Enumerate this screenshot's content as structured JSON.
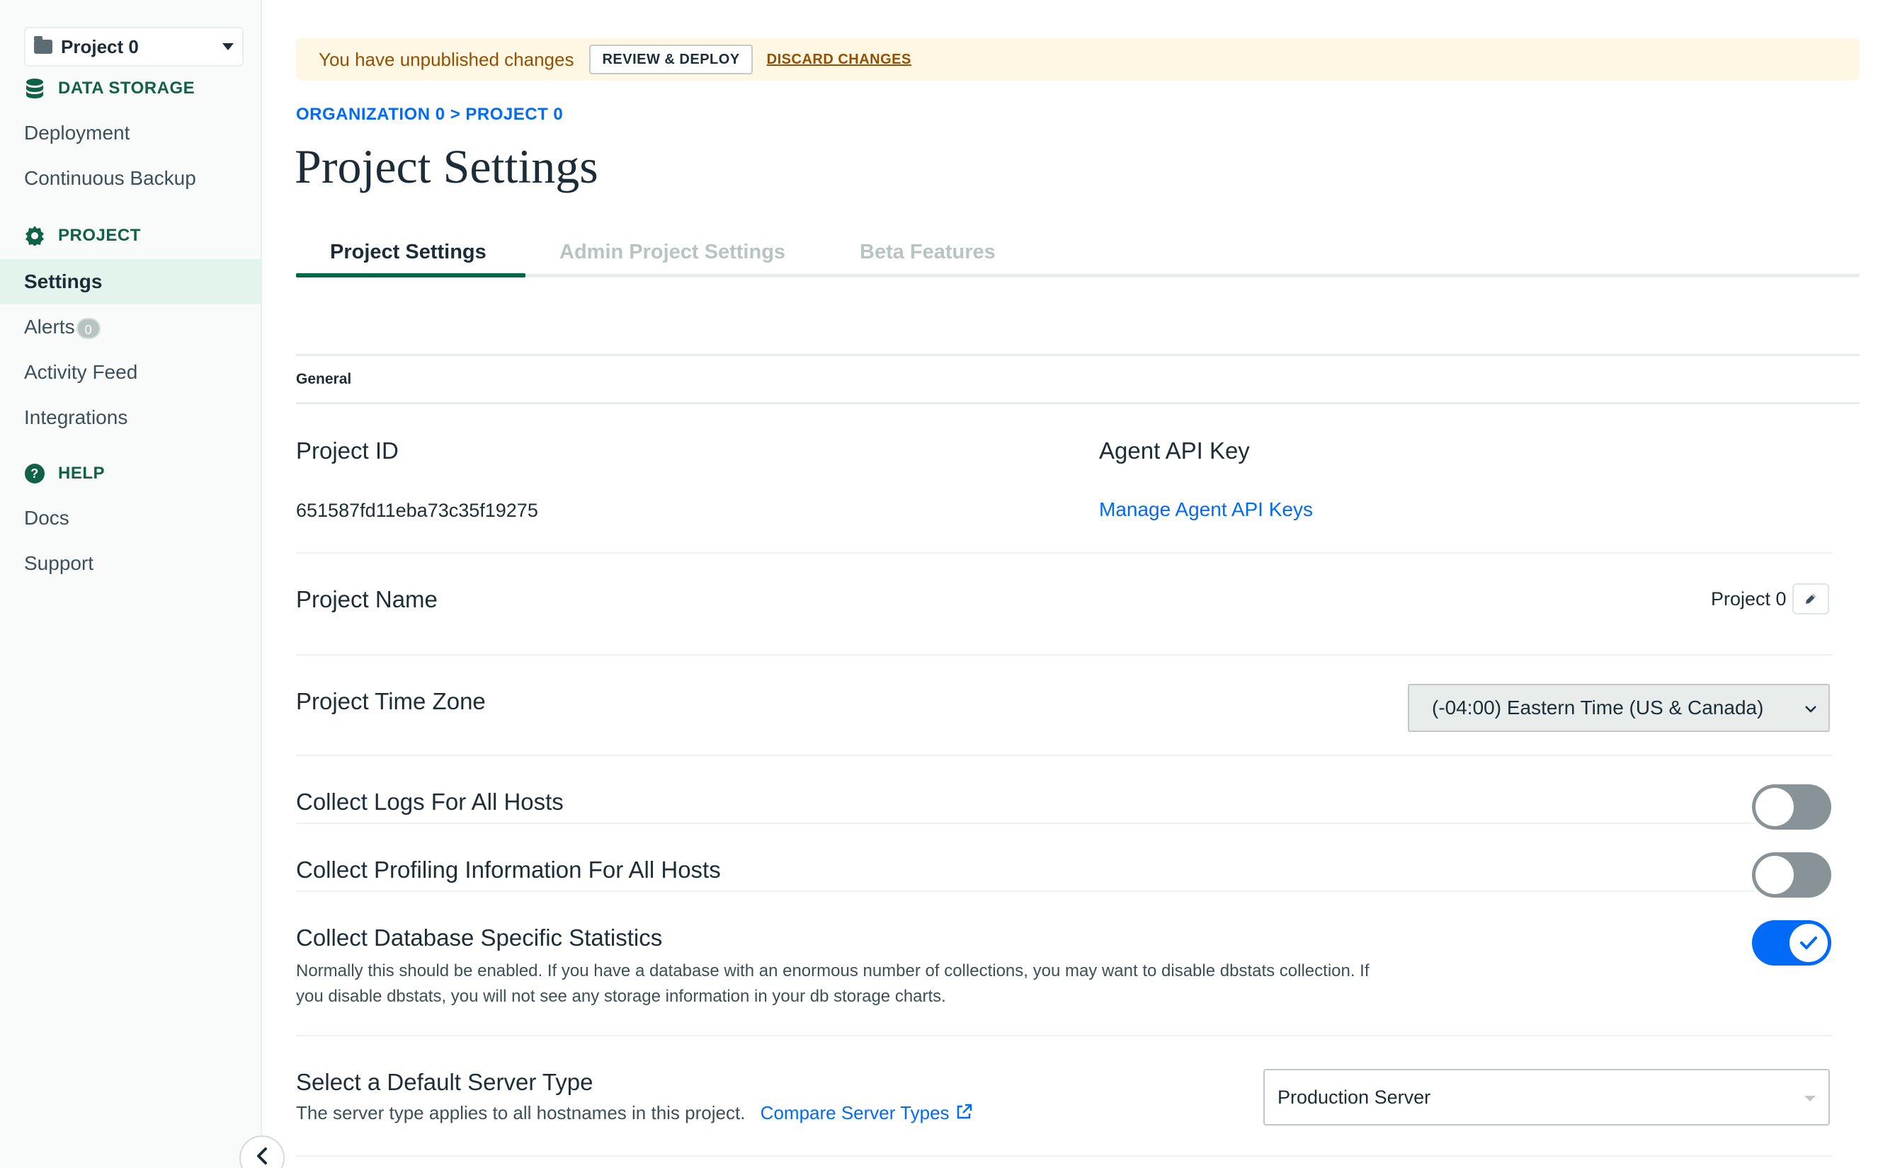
{
  "sidebar": {
    "project_selector": "Project 0",
    "sections": [
      {
        "title": "DATA STORAGE",
        "icon": "database-icon",
        "items": [
          "Deployment",
          "Continuous Backup"
        ]
      },
      {
        "title": "PROJECT",
        "icon": "gear-icon",
        "items": [
          "Settings",
          "Alerts",
          "Activity Feed",
          "Integrations"
        ]
      },
      {
        "title": "HELP",
        "icon": "help-circle-icon",
        "items": [
          "Docs",
          "Support"
        ]
      }
    ],
    "alerts_count": "0",
    "active_item": "Settings"
  },
  "banner": {
    "text": "You have unpublished changes",
    "review_label": "REVIEW & DEPLOY",
    "discard_label": "DISCARD CHANGES"
  },
  "breadcrumb": "ORGANIZATION 0 > PROJECT 0",
  "page_title": "Project Settings",
  "tabs": [
    {
      "label": "Project Settings",
      "active": true
    },
    {
      "label": "Admin Project Settings",
      "active": false
    },
    {
      "label": "Beta Features",
      "active": false
    }
  ],
  "general": {
    "heading": "General",
    "project_id_label": "Project ID",
    "project_id_value": "651587fd11eba73c35f19275",
    "agent_api_label": "Agent API Key",
    "agent_api_link": "Manage Agent API Keys",
    "project_name_label": "Project Name",
    "project_name_value": "Project 0",
    "timezone_label": "Project Time Zone",
    "timezone_value": "(-04:00) Eastern Time (US & Canada)",
    "collect_logs_label": "Collect Logs For All Hosts",
    "collect_logs_on": false,
    "collect_profiling_label": "Collect Profiling Information For All Hosts",
    "collect_profiling_on": false,
    "collect_db_stats_label": "Collect Database Specific Statistics",
    "collect_db_stats_on": true,
    "collect_db_stats_desc_1": "Normally this should be enabled. If you have a database with an enormous number of collections, you may want to disable dbstats collection. If",
    "collect_db_stats_desc_2": "you disable dbstats, you will not see any storage information in your db storage charts.",
    "server_type_label": "Select a Default Server Type",
    "server_type_desc": "The server type applies to all hostnames in this project.",
    "server_type_link": "Compare Server Types",
    "server_type_value": "Production Server"
  },
  "colors": {
    "accent_green": "#00684a",
    "link_blue": "#016bf8",
    "banner_bg": "#fef7e3",
    "banner_text": "#944f01"
  }
}
